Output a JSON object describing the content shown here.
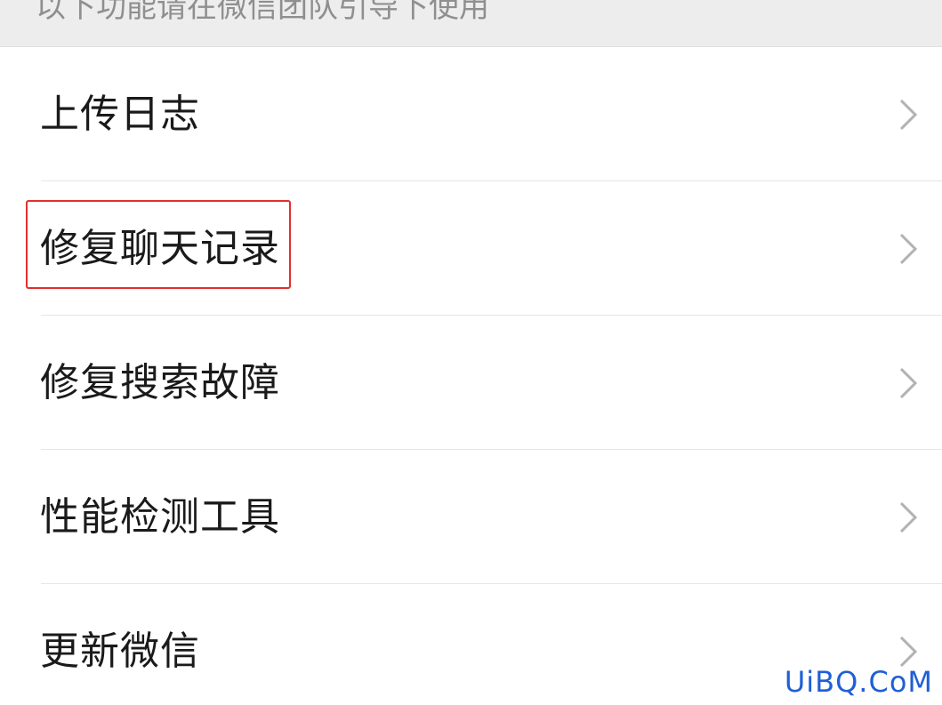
{
  "section_header": {
    "text": "以下功能请在微信团队引导下使用"
  },
  "menu": {
    "items": [
      {
        "label": "上传日志",
        "icon": "chevron-right-icon"
      },
      {
        "label": "修复聊天记录",
        "icon": "chevron-right-icon",
        "highlighted": true
      },
      {
        "label": "修复搜索故障",
        "icon": "chevron-right-icon"
      },
      {
        "label": "性能检测工具",
        "icon": "chevron-right-icon"
      },
      {
        "label": "更新微信",
        "icon": "chevron-right-icon"
      }
    ]
  },
  "watermark": {
    "text": "UiBQ.CoM"
  },
  "colors": {
    "highlight": "#e0302e",
    "watermark": "#1f5fd6",
    "header_bg": "#ededed",
    "text": "#1a1a1a",
    "muted_text": "#8f8f8f"
  }
}
